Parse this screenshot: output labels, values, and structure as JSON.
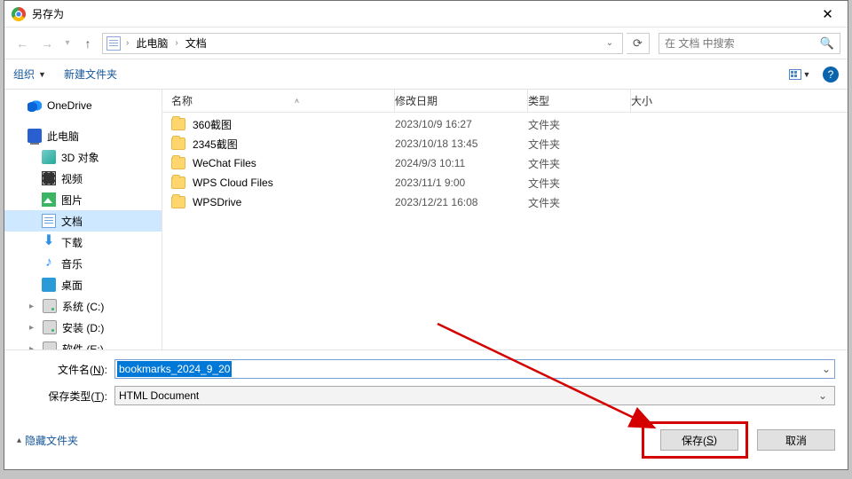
{
  "titlebar": {
    "title": "另存为"
  },
  "nav": {
    "breadcrumb": {
      "root": "此电脑",
      "current": "文档"
    },
    "search_placeholder": "在 文档 中搜索"
  },
  "toolbar": {
    "organize": "组织",
    "new_folder": "新建文件夹"
  },
  "tree": {
    "onedrive": "OneDrive",
    "thispc": "此电脑",
    "items": {
      "threeD": "3D 对象",
      "videos": "视频",
      "pictures": "图片",
      "documents": "文档",
      "downloads": "下载",
      "music": "音乐",
      "desktop": "桌面",
      "driveC": "系统 (C:)",
      "driveD": "安装 (D:)",
      "driveE": "软件 (E:)"
    }
  },
  "columns": {
    "name": "名称",
    "date": "修改日期",
    "type": "类型",
    "size": "大小"
  },
  "files": [
    {
      "name": "360截图",
      "date": "2023/10/9 16:27",
      "type": "文件夹"
    },
    {
      "name": "2345截图",
      "date": "2023/10/18 13:45",
      "type": "文件夹"
    },
    {
      "name": "WeChat Files",
      "date": "2024/9/3 10:11",
      "type": "文件夹"
    },
    {
      "name": "WPS Cloud Files",
      "date": "2023/11/1 9:00",
      "type": "文件夹"
    },
    {
      "name": "WPSDrive",
      "date": "2023/12/21 16:08",
      "type": "文件夹"
    }
  ],
  "bottom": {
    "filename_label_pre": "文件名(",
    "filename_label_u": "N",
    "filename_label_post": "):",
    "filetype_label_pre": "保存类型(",
    "filetype_label_u": "T",
    "filetype_label_post": "):",
    "filename_value": "bookmarks_2024_9_20",
    "filetype_value": "HTML Document",
    "hide_folders": "隐藏文件夹",
    "save_pre": "保存(",
    "save_u": "S",
    "save_post": ")",
    "cancel": "取消"
  }
}
